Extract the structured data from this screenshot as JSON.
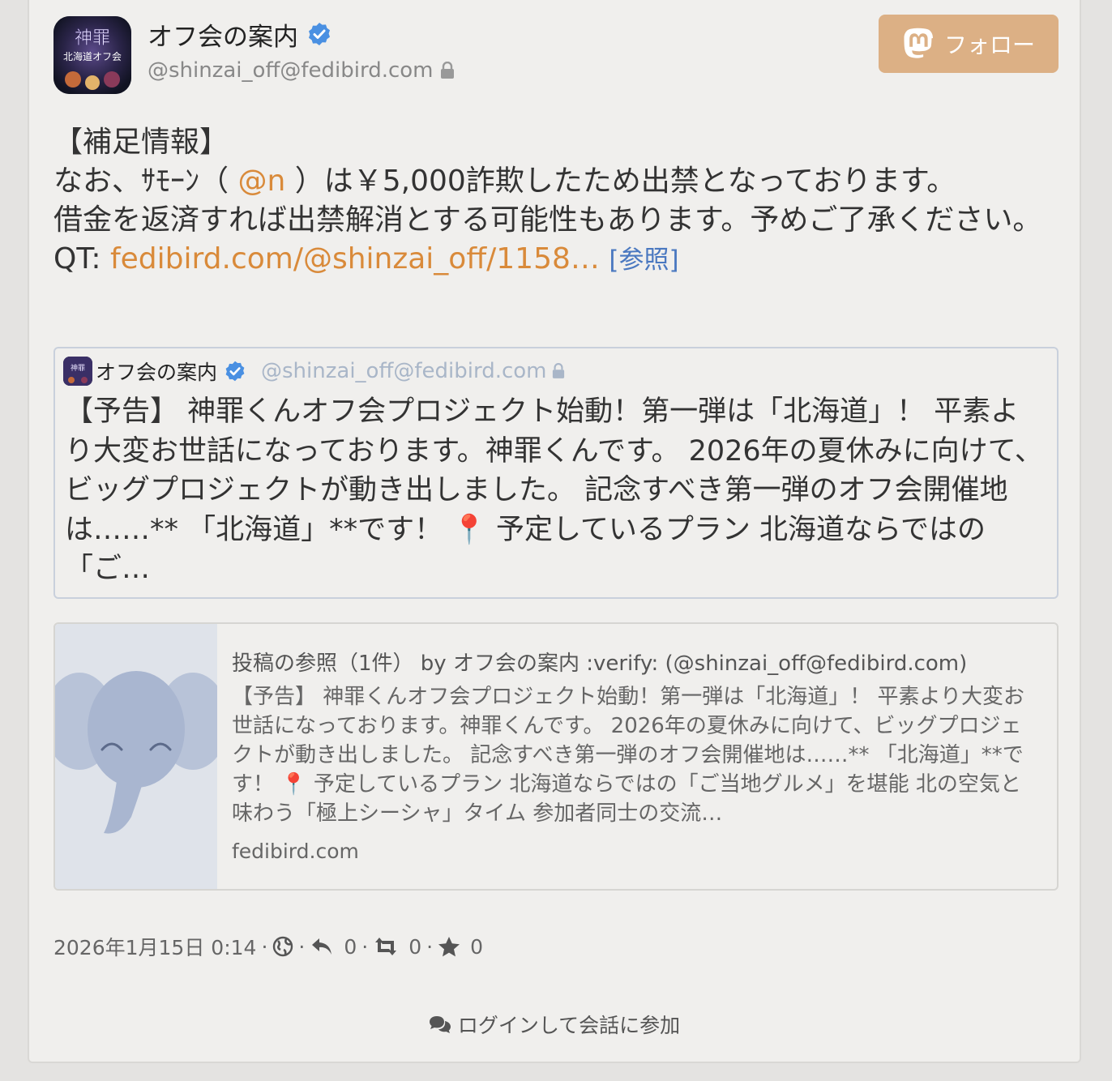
{
  "header": {
    "display_name": "オフ会の案内",
    "acct": "@shinzai_off@fedibird.com",
    "avatar_text_top": "神罪",
    "avatar_text_bottom": "北海道オフ会"
  },
  "follow": {
    "label": "フォロー"
  },
  "post": {
    "heading": "【補足情報】",
    "line1_before": "なお、ｻﾓｰﾝ（ ",
    "mention": "@n",
    "line1_after": " ）は￥5,000詐欺したため出禁となっております。",
    "line2": "借金を返済すれば出禁解消とする可能性もあります。予めご了承ください。",
    "qt_prefix": "QT: ",
    "qt_link": "fedibird.com/@shinzai_off/1158…",
    "ref_label": "[参照]"
  },
  "quote": {
    "display_name": "オフ会の案内",
    "acct": "@shinzai_off@fedibird.com",
    "body": "【予告】 神罪くんオフ会プロジェクト始動！第一弾は「北海道」！ 平素より大変お世話になっております。神罪くんです。 2026年の夏休みに向けて、ビッグプロジェクトが動き出しました。 記念すべき第一弾のオフ会開催地は……** 「北海道」**です！ 📍 予定しているプラン 北海道ならではの「ご…"
  },
  "preview": {
    "title": "投稿の参照（1件） by オフ会の案内 :verify: (@shinzai_off@fedibird.com)",
    "description": "【予告】 神罪くんオフ会プロジェクト始動！第一弾は「北海道」！ 平素より大変お世話になっております。神罪くんです。 2026年の夏休みに向けて、ビッグプロジェクトが動き出しました。 記念すべき第一弾のオフ会開催地は……** 「北海道」**です！ 📍 予定しているプラン 北海道ならではの「ご当地グルメ」を堪能 北の空気と味わう「極上シーシャ」タイム 参加者同士の交流…",
    "host": "fedibird.com"
  },
  "meta": {
    "timestamp": "2026年1月15日 0:14",
    "separator": "·",
    "replies": "0",
    "boosts": "0",
    "favourites": "0"
  },
  "login": {
    "label": "ログインして会話に参加"
  },
  "colors": {
    "accent": "#dcb085",
    "link": "#d98a3a",
    "verified": "#4a90e2",
    "ref_link": "#4a78c0"
  }
}
